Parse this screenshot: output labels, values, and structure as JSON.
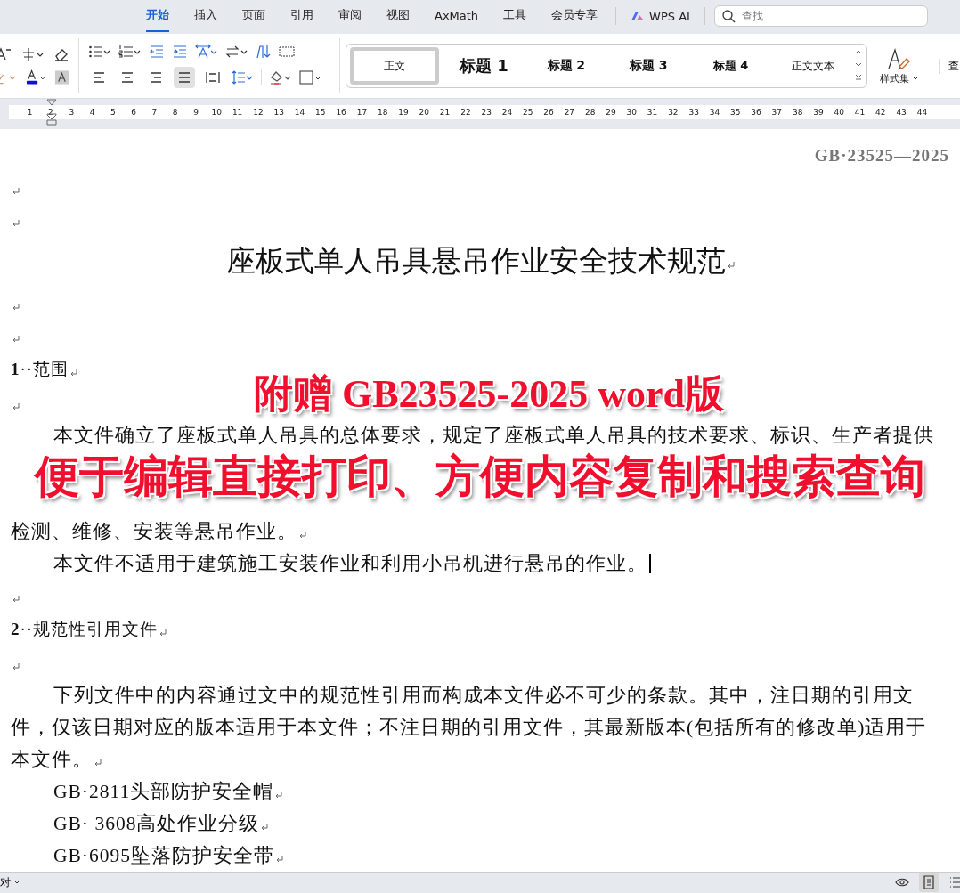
{
  "menu_tabs": [
    {
      "label": "开始",
      "selected": true
    },
    {
      "label": "插入",
      "selected": false
    },
    {
      "label": "页面",
      "selected": false
    },
    {
      "label": "引用",
      "selected": false
    },
    {
      "label": "审阅",
      "selected": false
    },
    {
      "label": "视图",
      "selected": false
    },
    {
      "label": "AxMath",
      "selected": false
    },
    {
      "label": "工具",
      "selected": false
    },
    {
      "label": "会员专享",
      "selected": false
    }
  ],
  "ai_button": {
    "label": "WPS AI"
  },
  "search": {
    "placeholder": "查找"
  },
  "alignment": [
    {
      "kind": "left",
      "selected": false
    },
    {
      "kind": "center",
      "selected": false
    },
    {
      "kind": "right",
      "selected": false
    },
    {
      "kind": "justify",
      "selected": true
    },
    {
      "kind": "distribute",
      "selected": false
    }
  ],
  "styles": [
    {
      "label": "正文",
      "kind": "normal",
      "selected": true
    },
    {
      "label": "标题 1",
      "kind": "h1",
      "selected": false
    },
    {
      "label": "标题 2",
      "kind": "h2",
      "selected": false
    },
    {
      "label": "标题 3",
      "kind": "h3",
      "selected": false
    },
    {
      "label": "标题 4",
      "kind": "h4",
      "selected": false
    },
    {
      "label": "正文文本",
      "kind": "body",
      "selected": false
    }
  ],
  "style_set": {
    "label": "样式集"
  },
  "cut_button": {
    "label": "查"
  },
  "ruler": {
    "numbers": [
      "1",
      "2",
      "3",
      "4",
      "5",
      "6",
      "7",
      "8",
      "9",
      "10",
      "11",
      "12",
      "13",
      "14",
      "15",
      "16",
      "17",
      "18",
      "19",
      "20",
      "21",
      "22",
      "23",
      "24",
      "25",
      "26",
      "27",
      "28",
      "29",
      "30",
      "31",
      "32",
      "33",
      "34",
      "35",
      "36",
      "37",
      "38",
      "39",
      "40",
      "41",
      "42",
      "43",
      "44"
    ]
  },
  "document": {
    "header": "GB·23525—2025",
    "blocks": [
      {
        "kind": "blank",
        "mark": true
      },
      {
        "kind": "blank",
        "mark": true
      },
      {
        "kind": "title",
        "text": "座板式单人吊具悬吊作业安全技术规范",
        "mark": true
      },
      {
        "kind": "blank",
        "mark": true
      },
      {
        "kind": "blank",
        "mark": true
      },
      {
        "kind": "heading",
        "number": "1",
        "text": "··范围",
        "mark": true
      },
      {
        "kind": "blank",
        "mark": true
      },
      {
        "kind": "first",
        "text": "本文件确立了座板式单人吊具的总体要求，规定了座板式单人吊具的技术要求、标识、生产者提供",
        "mark": false
      },
      {
        "kind": "hidden"
      },
      {
        "kind": "line",
        "text": "检测、维修、安装等悬吊作业。",
        "mark": true
      },
      {
        "kind": "first",
        "text": "本文件不适用于建筑施工安装作业和利用小吊机进行悬吊的作业。",
        "mark": false,
        "cursor": true
      },
      {
        "kind": "blank",
        "mark": true
      },
      {
        "kind": "heading",
        "number": "2",
        "text": "··规范性引用文件",
        "mark": true
      },
      {
        "kind": "blank",
        "mark": true
      },
      {
        "kind": "first",
        "text": "下列文件中的内容通过文中的规范性引用而构成本文件必不可少的条款。其中，注日期的引用文",
        "mark": false
      },
      {
        "kind": "line",
        "text": "件，仅该日期对应的版本适用于本文件；不注日期的引用文件，其最新版本(包括所有的修改单)适用于",
        "mark": false
      },
      {
        "kind": "line",
        "text": "本文件。",
        "mark": true
      },
      {
        "kind": "first",
        "text": "GB·2811头部防护安全帽",
        "mark": true
      },
      {
        "kind": "first",
        "text": "GB· 3608高处作业分级",
        "mark": true
      },
      {
        "kind": "first",
        "text": "GB·6095坠落防护安全带",
        "mark": true
      }
    ]
  },
  "overlay_caption": [
    "附赠 GB23525-2025 word版",
    "便于编辑直接打印、方便内容复制和搜索查询"
  ],
  "status_bar": {
    "left": "对",
    "views": [
      {
        "kind": "read",
        "selected": false
      },
      {
        "kind": "page",
        "selected": true
      },
      {
        "kind": "outline",
        "selected": false
      }
    ]
  }
}
